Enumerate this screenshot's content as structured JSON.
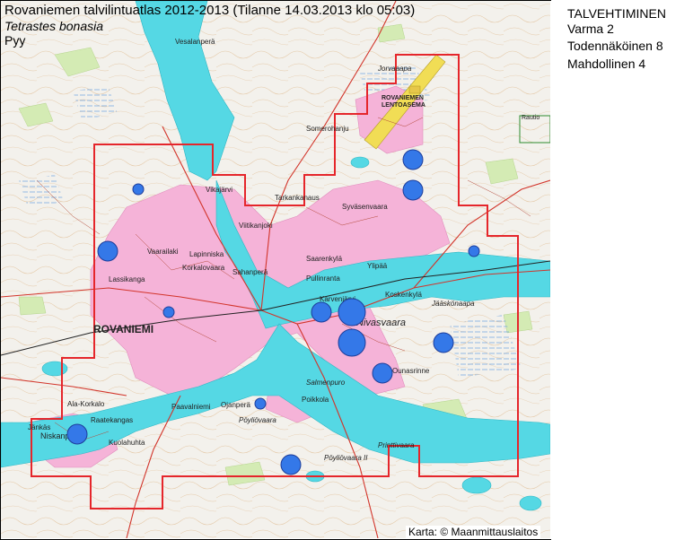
{
  "map": {
    "title": "Rovaniemen talvilintuatlas 2012-2013 (Tilanne 14.03.2013 klo 05:03)",
    "species_scientific": "Tetrastes bonasia",
    "species_common": "Pyy",
    "credit": "Karta: © Maanmittauslaitos",
    "colors": {
      "water": "#55d8e4",
      "urban": "#f5b3d8",
      "terrain": "#f3f1ec",
      "boundary": "#e5262b",
      "dot": "#3478e8",
      "dot_border": "#1d3d9a"
    },
    "place_names": [
      "ROVANIEMI",
      "Vesalanperä",
      "Jorvaaapa",
      "ROVANIEMEN LENTOASEMA",
      "Somerohanju",
      "Tarkankanaus",
      "Vikajärvi",
      "Viitikanjoki",
      "Syväsenvaara",
      "Saarenkylä",
      "Ylipää",
      "Pullinranta",
      "Karvenjärvi",
      "Nivasvaara",
      "Koskenkylä",
      "Jääskönaapa",
      "Ounasrinne",
      "Lapinniska",
      "Korkalovaara",
      "Sahanperä",
      "Lassikanga",
      "Vaarailaki",
      "Poikkola",
      "Salmenpuro",
      "Paavalniemi",
      "Ojanperä",
      "Pöyliövaara",
      "Ala-Korkalo",
      "Niskanperä",
      "Kuolahuhta",
      "Printtivaara",
      "Jänkäs",
      "Pöyliövaara II",
      "Raatekangas",
      "Rautio"
    ]
  },
  "legend": {
    "heading": "TALVEHTIMINEN",
    "items": [
      {
        "label": "Varma 2"
      },
      {
        "label": "Todennäköinen 8"
      },
      {
        "label": "Mahdollinen 4"
      }
    ]
  },
  "observations": [
    {
      "id": "obs-1",
      "size": "small"
    },
    {
      "id": "obs-2",
      "size": "medium"
    },
    {
      "id": "obs-3",
      "size": "small"
    },
    {
      "id": "obs-4",
      "size": "medium"
    },
    {
      "id": "obs-5",
      "size": "medium"
    },
    {
      "id": "obs-6",
      "size": "small"
    },
    {
      "id": "obs-7",
      "size": "medium"
    },
    {
      "id": "obs-8",
      "size": "large"
    },
    {
      "id": "obs-9",
      "size": "large"
    },
    {
      "id": "obs-10",
      "size": "medium"
    },
    {
      "id": "obs-11",
      "size": "medium"
    },
    {
      "id": "obs-12",
      "size": "small"
    },
    {
      "id": "obs-13",
      "size": "medium"
    },
    {
      "id": "obs-14",
      "size": "medium"
    }
  ]
}
